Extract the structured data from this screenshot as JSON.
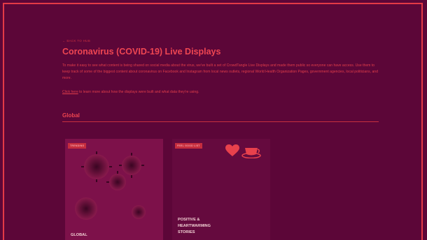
{
  "nav": {
    "back_label": "← BACK TO HUB"
  },
  "header": {
    "title": "Coronavirus (COVID-19) Live Displays"
  },
  "intro": {
    "description": "To make it easy to see what content is being shared on social media about the virus, we've built a set of CrowdTangle Live Displays and made them public so everyone can have access. Use them to keep track of some of the biggest content about coronavirus on Facebook and Instagram from local news outlets, regional World Health Organization Pages, government agencies, local politicians, and more.",
    "learn_link": "Click here",
    "learn_rest": " to learn more about how the displays were built and what data they're using."
  },
  "section": {
    "title": "Global"
  },
  "cards": [
    {
      "badge": "TRENDING",
      "title": "GLOBAL"
    },
    {
      "badge": "FEEL GOOD LIST",
      "title_lines": [
        "POSITIVE &",
        "HEARTWARMING",
        "STORIES"
      ]
    }
  ],
  "icons": {
    "heart": "heart-icon",
    "cup": "coffee-cup-icon",
    "virus": "virus-illustration"
  },
  "colors": {
    "background": "#5c0638",
    "accent": "#e8414c",
    "frame": "#e33a46"
  }
}
